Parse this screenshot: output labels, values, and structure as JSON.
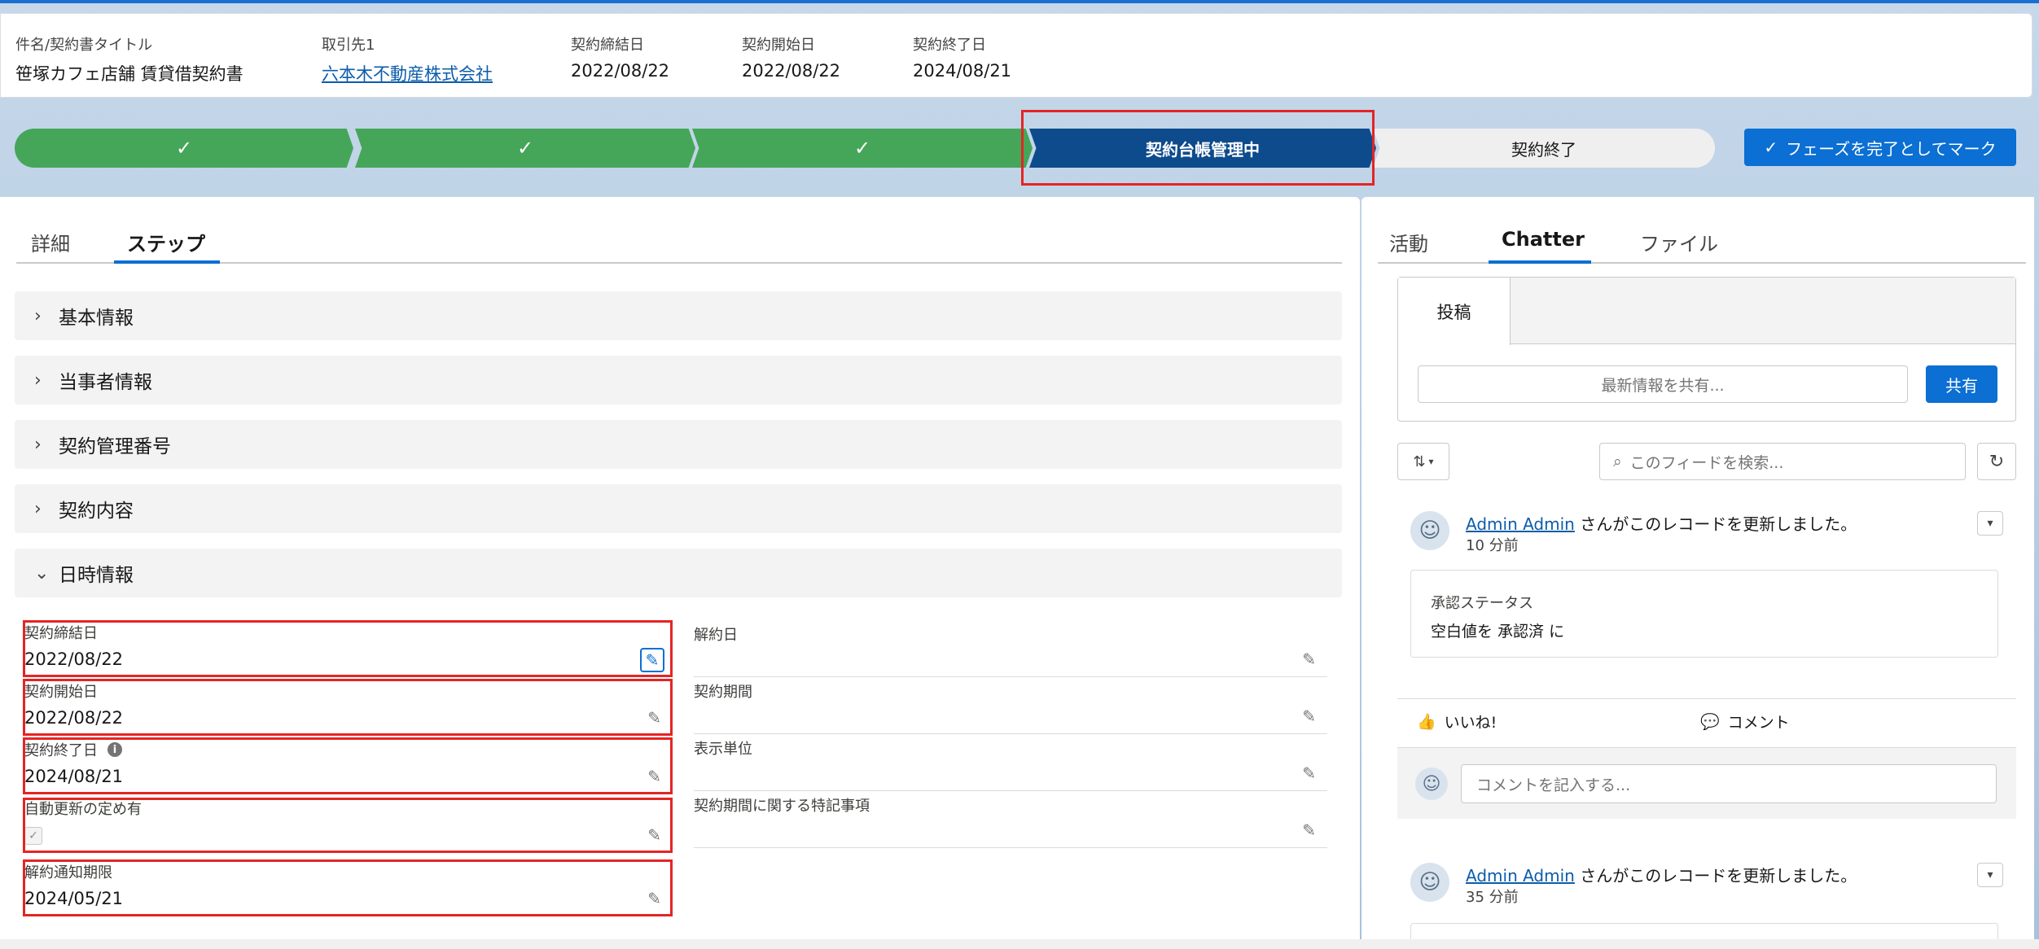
{
  "highlights": {
    "fields": [
      {
        "label": "件名/契約書タイトル",
        "value": "笹塚カフェ店舗 賃貸借契約書"
      },
      {
        "label": "取引先1",
        "value": "六本木不動産株式会社"
      },
      {
        "label": "契約締結日",
        "value": "2022/08/22"
      },
      {
        "label": "契約開始日",
        "value": "2022/08/22"
      },
      {
        "label": "契約終了日",
        "value": "2024/08/21"
      }
    ]
  },
  "path": {
    "stages": [
      {
        "label": "",
        "status": "completed"
      },
      {
        "label": "",
        "status": "completed"
      },
      {
        "label": "",
        "status": "completed"
      },
      {
        "label": "契約台帳管理中",
        "status": "current"
      },
      {
        "label": "契約終了",
        "status": "incomplete"
      }
    ],
    "mark_button": "フェーズを完了としてマーク"
  },
  "main": {
    "tabs": [
      {
        "label": "詳細",
        "active": false
      },
      {
        "label": "ステップ",
        "active": true
      }
    ],
    "sections": [
      {
        "label": "基本情報",
        "expanded": false
      },
      {
        "label": "当事者情報",
        "expanded": false
      },
      {
        "label": "契約管理番号",
        "expanded": false
      },
      {
        "label": "契約内容",
        "expanded": false
      },
      {
        "label": "日時情報",
        "expanded": true
      }
    ],
    "left_fields": [
      {
        "label": "契約締結日",
        "value": "2022/08/22"
      },
      {
        "label": "契約開始日",
        "value": "2022/08/22"
      },
      {
        "label": "契約終了日",
        "value": "2024/08/21"
      },
      {
        "label": "自動更新の定め有",
        "value": "",
        "checked": true
      },
      {
        "label": "解約通知期限",
        "value": "2024/05/21"
      }
    ],
    "right_fields": [
      {
        "label": "解約日",
        "value": ""
      },
      {
        "label": "契約期間",
        "value": ""
      },
      {
        "label": "表示単位",
        "value": ""
      },
      {
        "label": "契約期間に関する特記事項",
        "value": ""
      }
    ]
  },
  "side": {
    "tabs": [
      {
        "label": "活動",
        "active": false
      },
      {
        "label": "Chatter",
        "active": true
      },
      {
        "label": "ファイル",
        "active": false
      }
    ],
    "publisher": {
      "tab": "投稿",
      "placeholder": "最新情報を共有...",
      "share": "共有"
    },
    "feed_search_placeholder": "このフィードを検索...",
    "posts": [
      {
        "author": "Admin Admin",
        "text": " さんがこのレコードを更新しました。",
        "time": "10 分前",
        "change_label": "承認ステータス",
        "change_value": "空白値を 承認済 に"
      },
      {
        "author": "Admin Admin",
        "text": " さんがこのレコードを更新しました。",
        "time": "35 分前"
      }
    ],
    "like": "いいね!",
    "comment": "コメント",
    "comment_placeholder": "コメントを記入する..."
  },
  "colors": {
    "completed": "#45a65a",
    "current": "#0d4b8c",
    "brand": "#0b6fd3",
    "highlight": "#e52424"
  }
}
